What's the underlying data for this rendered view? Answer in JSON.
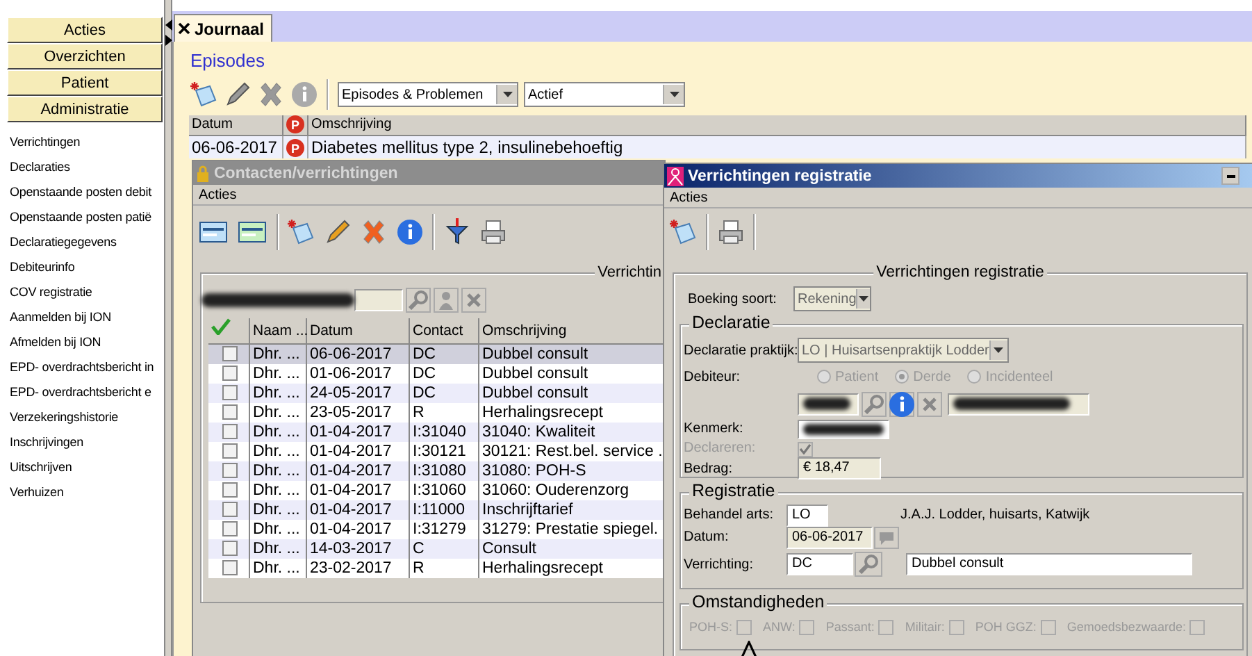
{
  "sidebar": {
    "sections": [
      {
        "label": "Acties"
      },
      {
        "label": "Overzichten"
      },
      {
        "label": "Patient"
      },
      {
        "label": "Administratie"
      }
    ],
    "items": [
      "Verrichtingen",
      "Declaraties",
      "Openstaande posten debit",
      "Openstaande posten patië",
      "Declaratiegegevens",
      "Debiteurinfo",
      "COV registratie",
      "Aanmelden bij ION",
      "Afmelden bij ION",
      "EPD- overdrachtsbericht in",
      "EPD- overdrachtsbericht e",
      "Verzekeringshistorie",
      "Inschrijvingen",
      "Uitschrijven",
      "Verhuizen"
    ]
  },
  "tabs": [
    {
      "label": "Journaal",
      "selected": true
    }
  ],
  "episodes": {
    "title": "Episodes",
    "filters": [
      {
        "value": "Episodes & Problemen"
      },
      {
        "value": "Actief"
      }
    ],
    "table": {
      "columns": [
        {
          "label": "Datum",
          "kind": "text"
        },
        {
          "label": "P",
          "kind": "badge"
        },
        {
          "label": "Omschrijving",
          "kind": "text"
        }
      ],
      "rows": [
        {
          "cells": [
            "06-06-2017",
            "P",
            "Diabetes mellitus type 2, insulinebehoeftig"
          ]
        }
      ]
    }
  },
  "contacts_window": {
    "title": "Contacten/verrichtingen",
    "menu": [
      "Acties"
    ],
    "group_title": "Verrichtin",
    "table": {
      "columns": [
        "Naam ...",
        "Datum",
        "Contact",
        "Omschrijving"
      ],
      "rows": [
        {
          "checked": false,
          "selected": true,
          "cells": [
            "Dhr. ...",
            "06-06-2017",
            "DC",
            "Dubbel consult"
          ]
        },
        {
          "checked": false,
          "selected": false,
          "cells": [
            "Dhr. ...",
            "01-06-2017",
            "DC",
            "Dubbel consult"
          ]
        },
        {
          "checked": false,
          "selected": false,
          "cells": [
            "Dhr. ...",
            "24-05-2017",
            "DC",
            "Dubbel consult"
          ]
        },
        {
          "checked": false,
          "selected": false,
          "cells": [
            "Dhr. ...",
            "23-05-2017",
            "R",
            "Herhalingsrecept"
          ]
        },
        {
          "checked": false,
          "selected": false,
          "cells": [
            "Dhr. ...",
            "01-04-2017",
            "I:31040",
            "31040: Kwaliteit"
          ]
        },
        {
          "checked": false,
          "selected": false,
          "cells": [
            "Dhr. ...",
            "01-04-2017",
            "I:30121",
            "30121: Rest.bel. service ."
          ]
        },
        {
          "checked": false,
          "selected": false,
          "cells": [
            "Dhr. ...",
            "01-04-2017",
            "I:31080",
            "31080: POH-S"
          ]
        },
        {
          "checked": false,
          "selected": false,
          "cells": [
            "Dhr. ...",
            "01-04-2017",
            "I:31060",
            "31060: Ouderenzorg"
          ]
        },
        {
          "checked": false,
          "selected": false,
          "cells": [
            "Dhr. ...",
            "01-04-2017",
            "I:11000",
            "Inschrijftarief"
          ]
        },
        {
          "checked": false,
          "selected": false,
          "cells": [
            "Dhr. ...",
            "01-04-2017",
            "I:31279",
            "31279: Prestatie spiegel."
          ]
        },
        {
          "checked": false,
          "selected": false,
          "cells": [
            "Dhr. ...",
            "14-03-2017",
            "C",
            "Consult"
          ]
        },
        {
          "checked": false,
          "selected": false,
          "cells": [
            "Dhr. ...",
            "23-02-2017",
            "R",
            "Herhalingsrecept"
          ]
        }
      ]
    }
  },
  "registration_window": {
    "title": "Verrichtingen registratie",
    "menu": [
      "Acties"
    ],
    "group_title": "Verrichtingen registratie",
    "boeking_soort": {
      "label": "Boeking soort:",
      "value": "Rekening"
    },
    "declaratie": {
      "title": "Declaratie",
      "praktijk": {
        "label": "Declaratie praktijk:",
        "value": "LO | Huisartsenpraktijk Lodder"
      },
      "debiteur": {
        "label": "Debiteur:",
        "options": [
          {
            "label": "Patient",
            "selected": false,
            "disabled": true
          },
          {
            "label": "Derde",
            "selected": true,
            "disabled": true
          },
          {
            "label": "Incidenteel",
            "selected": false,
            "disabled": true
          }
        ]
      },
      "kenmerk_label": "Kenmerk:",
      "declareren": {
        "label": "Declareren:",
        "checked": true,
        "disabled": true
      },
      "bedrag": {
        "label": "Bedrag:",
        "value": "€ 18,47"
      }
    },
    "registratie": {
      "title": "Registratie",
      "behandel_arts": {
        "label": "Behandel arts:",
        "value": "LO",
        "name": "J.A.J. Lodder, huisarts, Katwijk"
      },
      "datum": {
        "label": "Datum:",
        "value": "06-06-2017"
      },
      "verrichting": {
        "label": "Verrichting:",
        "code": "DC",
        "description": "Dubbel consult"
      }
    },
    "omstandigheden": {
      "title": "Omstandigheden",
      "items": [
        {
          "label": "POH-S:",
          "checked": false,
          "disabled": true
        },
        {
          "label": "ANW:",
          "checked": false,
          "disabled": true
        },
        {
          "label": "Passant:",
          "checked": false,
          "disabled": true
        },
        {
          "label": "Militair:",
          "checked": false,
          "disabled": true
        },
        {
          "label": "POH GGZ:",
          "checked": false,
          "disabled": true
        },
        {
          "label": "Gemoedsbezwaarde:",
          "checked": false,
          "disabled": true
        }
      ]
    }
  }
}
